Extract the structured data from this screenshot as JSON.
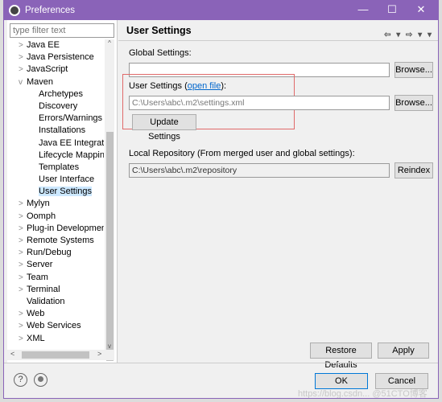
{
  "window": {
    "title": "Preferences",
    "minimize": "—",
    "maximize": "☐",
    "close": "✕"
  },
  "filter": {
    "placeholder": "type filter text"
  },
  "tree": [
    {
      "label": "Java EE",
      "arrow": ">",
      "indent": 0
    },
    {
      "label": "Java Persistence",
      "arrow": ">",
      "indent": 0
    },
    {
      "label": "JavaScript",
      "arrow": ">",
      "indent": 0
    },
    {
      "label": "Maven",
      "arrow": "v",
      "indent": 0
    },
    {
      "label": "Archetypes",
      "arrow": "",
      "indent": 1
    },
    {
      "label": "Discovery",
      "arrow": "",
      "indent": 1
    },
    {
      "label": "Errors/Warnings",
      "arrow": "",
      "indent": 1
    },
    {
      "label": "Installations",
      "arrow": "",
      "indent": 1
    },
    {
      "label": "Java EE Integration",
      "arrow": "",
      "indent": 1
    },
    {
      "label": "Lifecycle Mappings",
      "arrow": "",
      "indent": 1
    },
    {
      "label": "Templates",
      "arrow": "",
      "indent": 1
    },
    {
      "label": "User Interface",
      "arrow": "",
      "indent": 1
    },
    {
      "label": "User Settings",
      "arrow": "",
      "indent": 1,
      "selected": true
    },
    {
      "label": "Mylyn",
      "arrow": ">",
      "indent": 0
    },
    {
      "label": "Oomph",
      "arrow": ">",
      "indent": 0
    },
    {
      "label": "Plug-in Development",
      "arrow": ">",
      "indent": 0
    },
    {
      "label": "Remote Systems",
      "arrow": ">",
      "indent": 0
    },
    {
      "label": "Run/Debug",
      "arrow": ">",
      "indent": 0
    },
    {
      "label": "Server",
      "arrow": ">",
      "indent": 0
    },
    {
      "label": "Team",
      "arrow": ">",
      "indent": 0
    },
    {
      "label": "Terminal",
      "arrow": ">",
      "indent": 0
    },
    {
      "label": "Validation",
      "arrow": "",
      "indent": 0
    },
    {
      "label": "Web",
      "arrow": ">",
      "indent": 0
    },
    {
      "label": "Web Services",
      "arrow": ">",
      "indent": 0
    },
    {
      "label": "XML",
      "arrow": ">",
      "indent": 0
    }
  ],
  "page": {
    "title": "User Settings",
    "nav": "⇦ ▾ ⇨ ▾ ▾",
    "global_label": "Global Settings:",
    "global_value": "",
    "browse": "Browse...",
    "user_label_pre": "User Settings (",
    "user_link": "open file",
    "user_label_post": "):",
    "user_value": "C:\\Users\\abc\\.m2\\settings.xml",
    "update": "Update Settings",
    "local_label": "Local Repository (From merged user and global settings):",
    "local_value": "C:\\Users\\abc\\.m2\\repository",
    "reindex": "Reindex",
    "restore": "Restore Defaults",
    "apply": "Apply"
  },
  "footer": {
    "help": "?",
    "ok": "OK",
    "cancel": "Cancel"
  },
  "watermark": "https://blog.csdn... @51CTO博客",
  "colors": {
    "titlebar": "#8a63b8",
    "highlight_box": "#e06a6a",
    "selection": "#cce8ff",
    "link": "#0066cc"
  }
}
